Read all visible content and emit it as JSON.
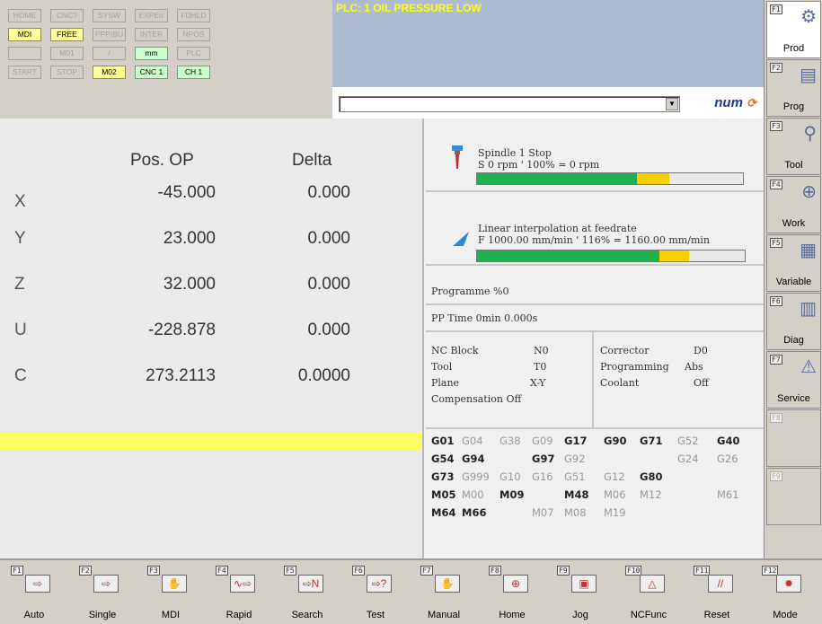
{
  "status_buttons": [
    {
      "label": "HOME",
      "state": "inactive"
    },
    {
      "label": "CNC?",
      "state": "inactive"
    },
    {
      "label": "SYSW",
      "state": "inactive"
    },
    {
      "label": "EXPErr",
      "state": "inactive"
    },
    {
      "label": "FDHLD",
      "state": "inactive"
    },
    {
      "label": "MDI",
      "state": "yellow"
    },
    {
      "label": "FREE",
      "state": "yellow"
    },
    {
      "label": "PPP/BU",
      "state": "inactive"
    },
    {
      "label": "INTER",
      "state": "inactive"
    },
    {
      "label": "NPOS",
      "state": "inactive"
    },
    {
      "label": "",
      "state": "inactive"
    },
    {
      "label": "M01",
      "state": "inactive"
    },
    {
      "label": "/",
      "state": "inactive"
    },
    {
      "label": "mm",
      "state": "green"
    },
    {
      "label": "PLC",
      "state": "inactive"
    },
    {
      "label": "START",
      "state": "inactive"
    },
    {
      "label": "STOP",
      "state": "inactive"
    },
    {
      "label": "M02",
      "state": "yellow"
    },
    {
      "label": "CNC 1",
      "state": "green"
    },
    {
      "label": "CH 1",
      "state": "green"
    }
  ],
  "alarm": {
    "message": "PLC: 1 OIL PRESSURE LOW"
  },
  "command": {
    "value": "",
    "logo": "num"
  },
  "axes": {
    "headers": {
      "pos": "Pos. OP",
      "delta": "Delta"
    },
    "rows": [
      {
        "name": "X",
        "pos": "-45.000",
        "delta": "0.000"
      },
      {
        "name": "Y",
        "pos": "23.000",
        "delta": "0.000"
      },
      {
        "name": "Z",
        "pos": "32.000",
        "delta": "0.000"
      },
      {
        "name": "U",
        "pos": "-228.878",
        "delta": "0.000"
      },
      {
        "name": "C",
        "pos": "273.2113",
        "delta": "0.0000"
      }
    ]
  },
  "spindle": {
    "title": "Spindle 1 Stop",
    "detail": "S 0 rpm ' 100% = 0 rpm",
    "green_fraction": 0.6,
    "amber_fraction": 0.12
  },
  "feed": {
    "title": "Linear interpolation at feedrate",
    "detail": "F 1000.00 mm/min ' 116% = 1160.00 mm/min",
    "green_fraction": 0.68,
    "amber_fraction": 0.11
  },
  "programme": "Programme %0",
  "pp_time": "PP Time 0min 0.000s",
  "nc_info": {
    "nc_block_label": "NC Block",
    "nc_block_value": "N0",
    "tool_label": "Tool",
    "tool_value": "T0",
    "plane_label": "Plane",
    "plane_value": "X-Y",
    "compensation": "Compensation Off",
    "corrector_label": "Corrector",
    "corrector_value": "D0",
    "programming_label": "Programming",
    "programming_value": "Abs",
    "coolant_label": "Coolant",
    "coolant_value": "Off"
  },
  "gcodes": [
    [
      {
        "t": "G01",
        "on": true
      },
      {
        "t": "G04",
        "on": false
      },
      {
        "t": "G38",
        "on": false
      },
      {
        "t": "G09",
        "on": false
      },
      {
        "t": "G17",
        "on": true
      },
      {
        "t": "G90",
        "on": true
      },
      {
        "t": "G71",
        "on": true
      },
      {
        "t": "G52",
        "on": false
      },
      {
        "t": "G40",
        "on": true
      }
    ],
    [
      {
        "t": "G54",
        "on": true
      },
      {
        "t": "G94",
        "on": true
      },
      {
        "t": "",
        "on": false
      },
      {
        "t": "G97",
        "on": true
      },
      {
        "t": "G92",
        "on": false
      },
      {
        "t": "",
        "on": false
      },
      {
        "t": "",
        "on": false
      },
      {
        "t": "G24",
        "on": false
      },
      {
        "t": "G26",
        "on": false
      }
    ],
    [
      {
        "t": "G73",
        "on": true
      },
      {
        "t": "G999",
        "on": false
      },
      {
        "t": "G10",
        "on": false
      },
      {
        "t": "G16",
        "on": false
      },
      {
        "t": "G51",
        "on": false
      },
      {
        "t": "G12",
        "on": false
      },
      {
        "t": "G80",
        "on": true
      },
      {
        "t": "",
        "on": false
      },
      {
        "t": "",
        "on": false
      }
    ],
    [
      {
        "t": "M05",
        "on": true
      },
      {
        "t": "M00",
        "on": false
      },
      {
        "t": "M09",
        "on": true
      },
      {
        "t": "",
        "on": false
      },
      {
        "t": "M48",
        "on": true
      },
      {
        "t": "M06",
        "on": false
      },
      {
        "t": "M12",
        "on": false
      },
      {
        "t": "",
        "on": false
      },
      {
        "t": "M61",
        "on": false
      }
    ],
    [
      {
        "t": "M64",
        "on": true
      },
      {
        "t": "M66",
        "on": true
      },
      {
        "t": "",
        "on": false
      },
      {
        "t": "M07",
        "on": false
      },
      {
        "t": "M08",
        "on": false
      },
      {
        "t": "M19",
        "on": false
      },
      {
        "t": "",
        "on": false
      },
      {
        "t": "",
        "on": false
      },
      {
        "t": "",
        "on": false
      }
    ]
  ],
  "right_keys": [
    {
      "fk": "F1",
      "label": "Prod",
      "icon": "gears-icon",
      "selected": true
    },
    {
      "fk": "F2",
      "label": "Prog",
      "icon": "document-icon",
      "selected": false
    },
    {
      "fk": "F3",
      "label": "Tool",
      "icon": "tool-icon",
      "selected": false
    },
    {
      "fk": "F4",
      "label": "Work",
      "icon": "work-offset-icon",
      "selected": false
    },
    {
      "fk": "F5",
      "label": "Variable",
      "icon": "variable-icon",
      "selected": false
    },
    {
      "fk": "F6",
      "label": "Diag",
      "icon": "diag-icon",
      "selected": false
    },
    {
      "fk": "F7",
      "label": "Service",
      "icon": "warning-icon",
      "selected": false
    },
    {
      "fk": "F8",
      "label": "",
      "icon": "",
      "selected": false
    },
    {
      "fk": "F9",
      "label": "",
      "icon": "",
      "selected": false
    }
  ],
  "bottom_keys": [
    {
      "fk": "F1",
      "label": "Auto",
      "glyph": "⇨"
    },
    {
      "fk": "F2",
      "label": "Single",
      "glyph": "⇨"
    },
    {
      "fk": "F3",
      "label": "MDI",
      "glyph": "✋"
    },
    {
      "fk": "F4",
      "label": "Rapid",
      "glyph": "∿⇨"
    },
    {
      "fk": "F5",
      "label": "Search",
      "glyph": "⇨N"
    },
    {
      "fk": "F6",
      "label": "Test",
      "glyph": "⇨?"
    },
    {
      "fk": "F7",
      "label": "Manual",
      "glyph": "✋"
    },
    {
      "fk": "F8",
      "label": "Home",
      "glyph": "⊕"
    },
    {
      "fk": "F9",
      "label": "Jog",
      "glyph": "▣"
    },
    {
      "fk": "F10",
      "label": "NCFunc",
      "glyph": "△"
    },
    {
      "fk": "F11",
      "label": "Reset",
      "glyph": "//"
    },
    {
      "fk": "F12",
      "label": "Mode",
      "glyph": "✹"
    }
  ],
  "colors": {
    "alarm_text": "#ffff00",
    "alarm_bg": "#afbbd3",
    "active_yellow": "#ffff99",
    "active_green": "#ccffcc",
    "bar_green": "#20b050",
    "bar_amber": "#f8d000"
  }
}
